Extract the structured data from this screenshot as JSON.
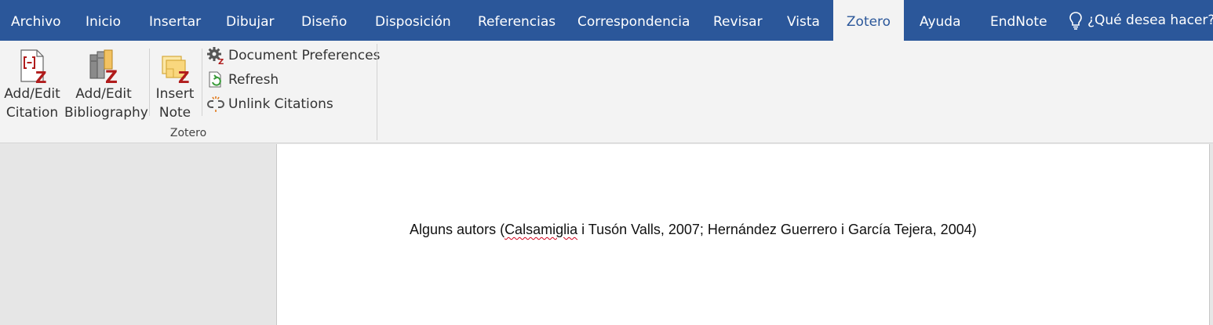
{
  "menu": {
    "tabs": [
      "Archivo",
      "Inicio",
      "Insertar",
      "Dibujar",
      "Diseño",
      "Disposición",
      "Referencias",
      "Correspondencia",
      "Revisar",
      "Vista",
      "Zotero",
      "Ayuda",
      "EndNote"
    ],
    "active_tab": "Zotero",
    "tell_me": "¿Qué desea hacer?"
  },
  "ribbon": {
    "add_edit_citation": {
      "line1": "Add/Edit",
      "line2": "Citation"
    },
    "add_edit_bibliography": {
      "line1": "Add/Edit",
      "line2": "Bibliography"
    },
    "insert_note": {
      "line1": "Insert",
      "line2": "Note"
    },
    "document_preferences": "Document Preferences",
    "refresh": "Refresh",
    "unlink_citations": "Unlink Citations",
    "group_label": "Zotero"
  },
  "document": {
    "before": "Alguns autors (",
    "flagged_word": "Calsamiglia",
    "after": " i Tusón Valls, 2007; Hernández Guerrero i García Tejera, 2004)"
  },
  "colors": {
    "titlebar": "#2b579a",
    "ribbon": "#f3f3f3",
    "zotero_red": "#b01c1c",
    "spell_error": "#d0021b"
  }
}
